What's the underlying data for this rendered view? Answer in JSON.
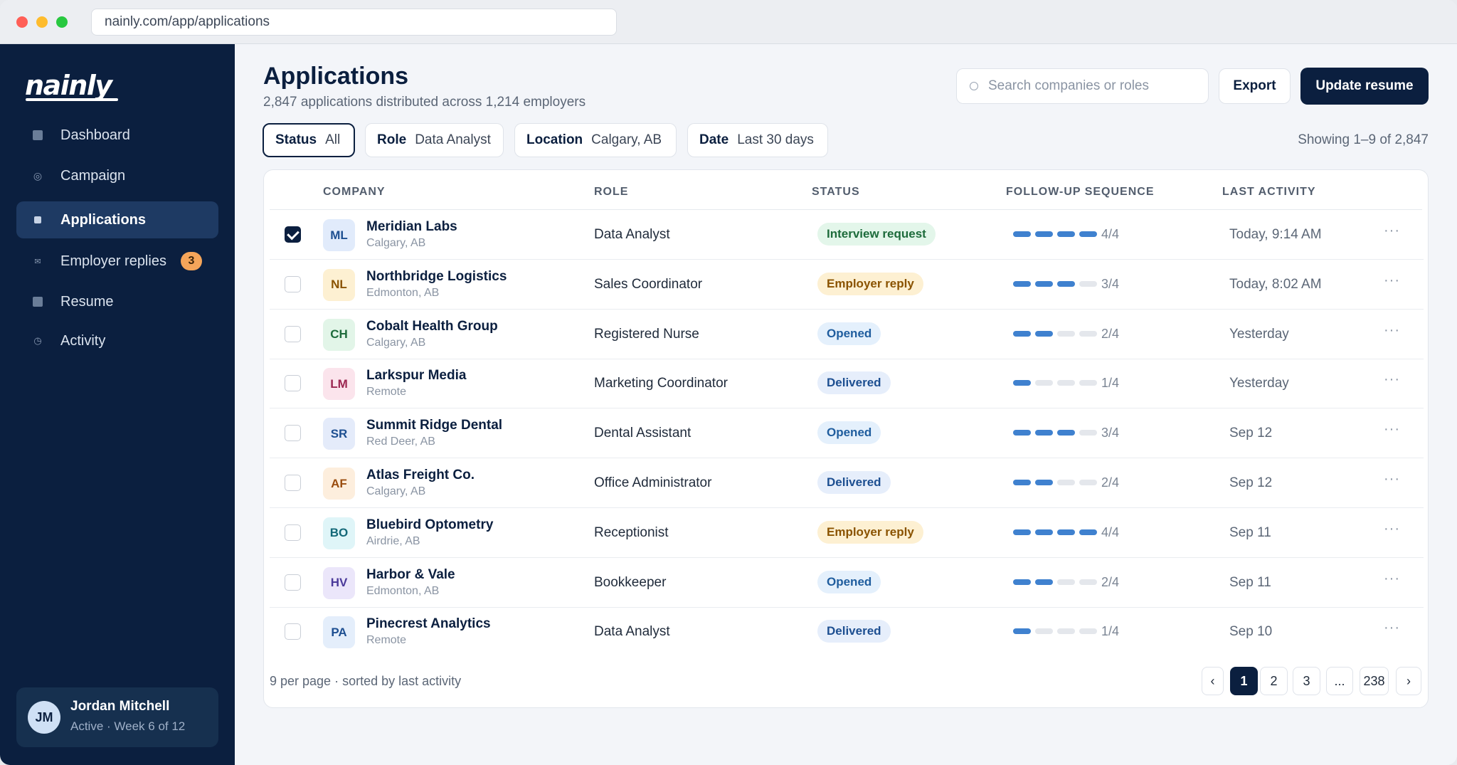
{
  "browser": {
    "url": "nainly.com/app/applications"
  },
  "sidebar": {
    "logo": "nainly",
    "items": [
      {
        "label": "Dashboard",
        "icon": "square-icon"
      },
      {
        "label": "Campaign",
        "icon": "target-icon"
      },
      {
        "label": "Applications",
        "icon": "square-icon",
        "active": true
      },
      {
        "label": "Employer replies",
        "icon": "mail-icon",
        "badge": "3"
      },
      {
        "label": "Resume",
        "icon": "square-icon"
      },
      {
        "label": "Activity",
        "icon": "clock-icon"
      }
    ],
    "user": {
      "initials": "JM",
      "name": "Jordan Mitchell",
      "status": "Active · Week 6 of 12"
    }
  },
  "header": {
    "title": "Applications",
    "subtitle": "2,847 applications distributed across 1,214 employers",
    "search_placeholder": "Search companies or roles",
    "export_label": "Export",
    "update_label": "Update resume"
  },
  "filters": [
    {
      "key": "Status",
      "value": "All"
    },
    {
      "key": "Role",
      "value": "Data Analyst"
    },
    {
      "key": "Location",
      "value": "Calgary, AB"
    },
    {
      "key": "Date",
      "value": "Last 30 days"
    }
  ],
  "showing": "Showing 1–9 of 2,847",
  "table": {
    "headers": [
      "COMPANY",
      "ROLE",
      "STATUS",
      "FOLLOW-UP SEQUENCE",
      "LAST ACTIVITY"
    ],
    "rows": [
      {
        "initials": "ML",
        "company": "Meridian Labs",
        "location": "Calgary, AB",
        "role": "Data Analyst",
        "status": "Interview request",
        "seq_done": 4,
        "seq_label": "4/4",
        "activity": "Today, 9:14 AM",
        "checked": true
      },
      {
        "initials": "NL",
        "company": "Northbridge Logistics",
        "location": "Edmonton, AB",
        "role": "Sales Coordinator",
        "status": "Employer reply",
        "seq_done": 3,
        "seq_label": "3/4",
        "activity": "Today, 8:02 AM"
      },
      {
        "initials": "CH",
        "company": "Cobalt Health Group",
        "location": "Calgary, AB",
        "role": "Registered Nurse",
        "status": "Opened",
        "seq_done": 2,
        "seq_label": "2/4",
        "activity": "Yesterday"
      },
      {
        "initials": "LM",
        "company": "Larkspur Media",
        "location": "Remote",
        "role": "Marketing Coordinator",
        "status": "Delivered",
        "seq_done": 1,
        "seq_label": "1/4",
        "activity": "Yesterday"
      },
      {
        "initials": "SR",
        "company": "Summit Ridge Dental",
        "location": "Red Deer, AB",
        "role": "Dental Assistant",
        "status": "Opened",
        "seq_done": 3,
        "seq_label": "3/4",
        "activity": "Sep 12"
      },
      {
        "initials": "AF",
        "company": "Atlas Freight Co.",
        "location": "Calgary, AB",
        "role": "Office Administrator",
        "status": "Delivered",
        "seq_done": 2,
        "seq_label": "2/4",
        "activity": "Sep 12"
      },
      {
        "initials": "BO",
        "company": "Bluebird Optometry",
        "location": "Airdrie, AB",
        "role": "Receptionist",
        "status": "Employer reply",
        "seq_done": 4,
        "seq_label": "4/4",
        "activity": "Sep 11"
      },
      {
        "initials": "HV",
        "company": "Harbor & Vale",
        "location": "Edmonton, AB",
        "role": "Bookkeeper",
        "status": "Opened",
        "seq_done": 2,
        "seq_label": "2/4",
        "activity": "Sep 11"
      },
      {
        "initials": "PA",
        "company": "Pinecrest Analytics",
        "location": "Remote",
        "role": "Data Analyst",
        "status": "Delivered",
        "seq_done": 1,
        "seq_label": "1/4",
        "activity": "Sep 10"
      }
    ],
    "more_label": "···"
  },
  "footer": {
    "info": "9 per page · sorted by last activity",
    "pages": [
      "‹",
      "1",
      "2",
      "3",
      "...",
      "238",
      "›"
    ],
    "current_page": "1"
  },
  "colors": {
    "navy": "#0b1f3f",
    "accent_blue": "#3f81cf",
    "badge_orange": "#f5a55a"
  }
}
